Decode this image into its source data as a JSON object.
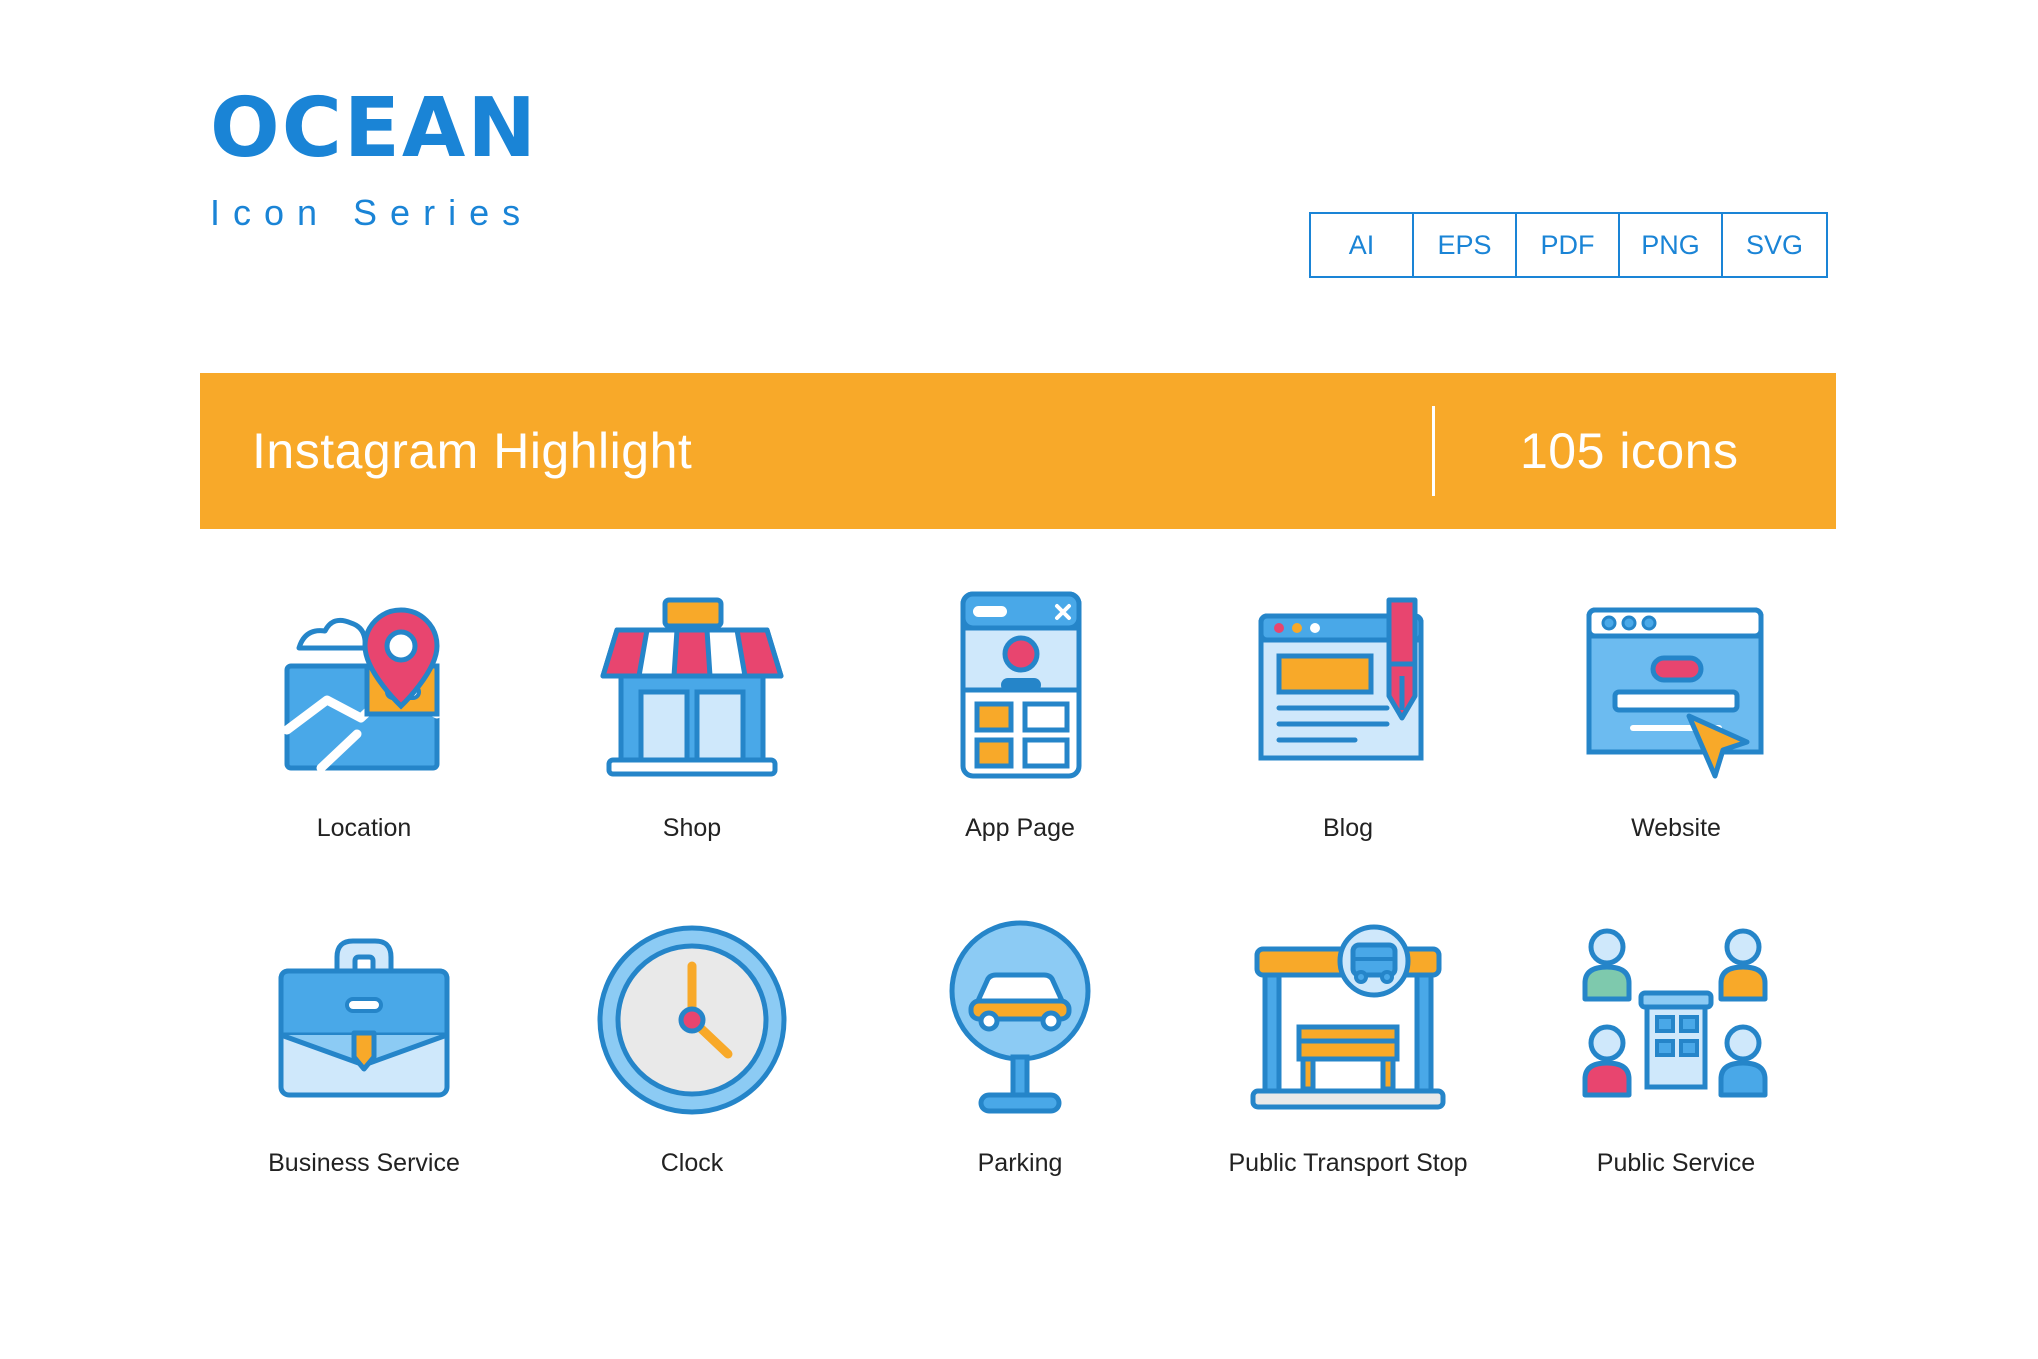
{
  "brand": {
    "title": "OCEAN",
    "subtitle": "Icon Series"
  },
  "formats": [
    "AI",
    "EPS",
    "PDF",
    "PNG",
    "SVG"
  ],
  "banner": {
    "title": "Instagram Highlight",
    "count": "105 icons",
    "bg_color": "#f8a929"
  },
  "colors": {
    "brand_blue": "#1a84d6",
    "outline_blue": "#2585c9",
    "light_blue": "#cfe8fb",
    "mid_blue": "#49a8e8",
    "orange": "#f8a929",
    "pink": "#e8456f",
    "white": "#ffffff",
    "grey": "#e9e9e9"
  },
  "icons": [
    {
      "name": "Location",
      "icon": "location-icon"
    },
    {
      "name": "Shop",
      "icon": "shop-icon"
    },
    {
      "name": "App Page",
      "icon": "app-page-icon"
    },
    {
      "name": "Blog",
      "icon": "blog-icon"
    },
    {
      "name": "Website",
      "icon": "website-icon"
    },
    {
      "name": "Business Service",
      "icon": "briefcase-icon"
    },
    {
      "name": "Clock",
      "icon": "clock-icon"
    },
    {
      "name": "Parking",
      "icon": "parking-icon"
    },
    {
      "name": "Public Transport Stop",
      "icon": "bus-stop-icon"
    },
    {
      "name": "Public Service",
      "icon": "public-service-icon"
    }
  ]
}
